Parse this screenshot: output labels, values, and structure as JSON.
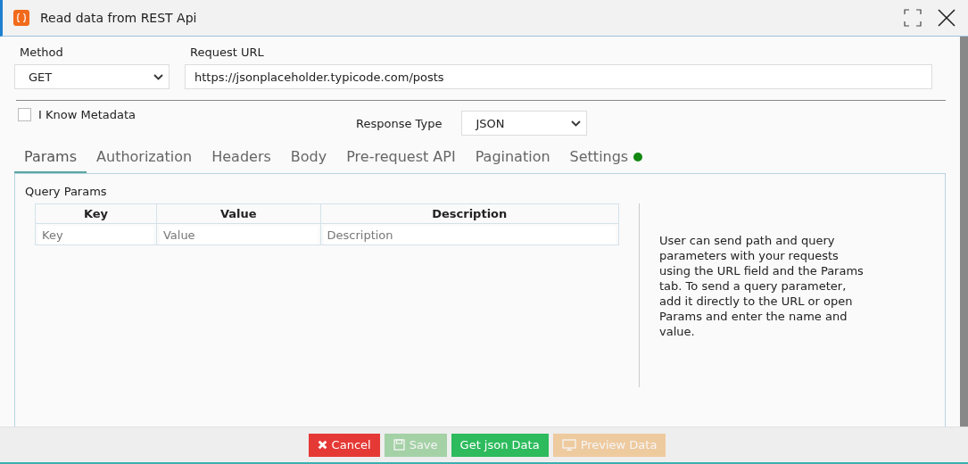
{
  "window": {
    "title": "Read data from REST Api"
  },
  "method": {
    "label": "Method",
    "value": "GET"
  },
  "request_url": {
    "label": "Request URL",
    "value": "https://jsonplaceholder.typicode.com/posts"
  },
  "metadata_checkbox": {
    "label": "I Know Metadata",
    "checked": false
  },
  "response_type": {
    "label": "Response Type",
    "value": "JSON"
  },
  "tabs": [
    {
      "label": "Params",
      "selected": true,
      "indicator": false
    },
    {
      "label": "Authorization",
      "selected": false,
      "indicator": false
    },
    {
      "label": "Headers",
      "selected": false,
      "indicator": false
    },
    {
      "label": "Body",
      "selected": false,
      "indicator": false
    },
    {
      "label": "Pre-request API",
      "selected": false,
      "indicator": false
    },
    {
      "label": "Pagination",
      "selected": false,
      "indicator": false
    },
    {
      "label": "Settings",
      "selected": false,
      "indicator": true
    }
  ],
  "params": {
    "title": "Query Params",
    "columns": [
      "Key",
      "Value",
      "Description"
    ],
    "rows": [
      {
        "placeholders": [
          "Key",
          "Value",
          "Description"
        ]
      }
    ],
    "help_text": "User can send path and query parameters with your requests using the URL field and the Params tab. To send a query parameter, add it directly to the URL or open Params and enter the name and value."
  },
  "buttons": [
    {
      "label": "Cancel",
      "kind": "cancel",
      "disabled": false
    },
    {
      "label": "Save",
      "kind": "save",
      "disabled": true
    },
    {
      "label": "Get json Data",
      "kind": "get",
      "disabled": false
    },
    {
      "label": "Preview Data",
      "kind": "preview",
      "disabled": true
    }
  ]
}
